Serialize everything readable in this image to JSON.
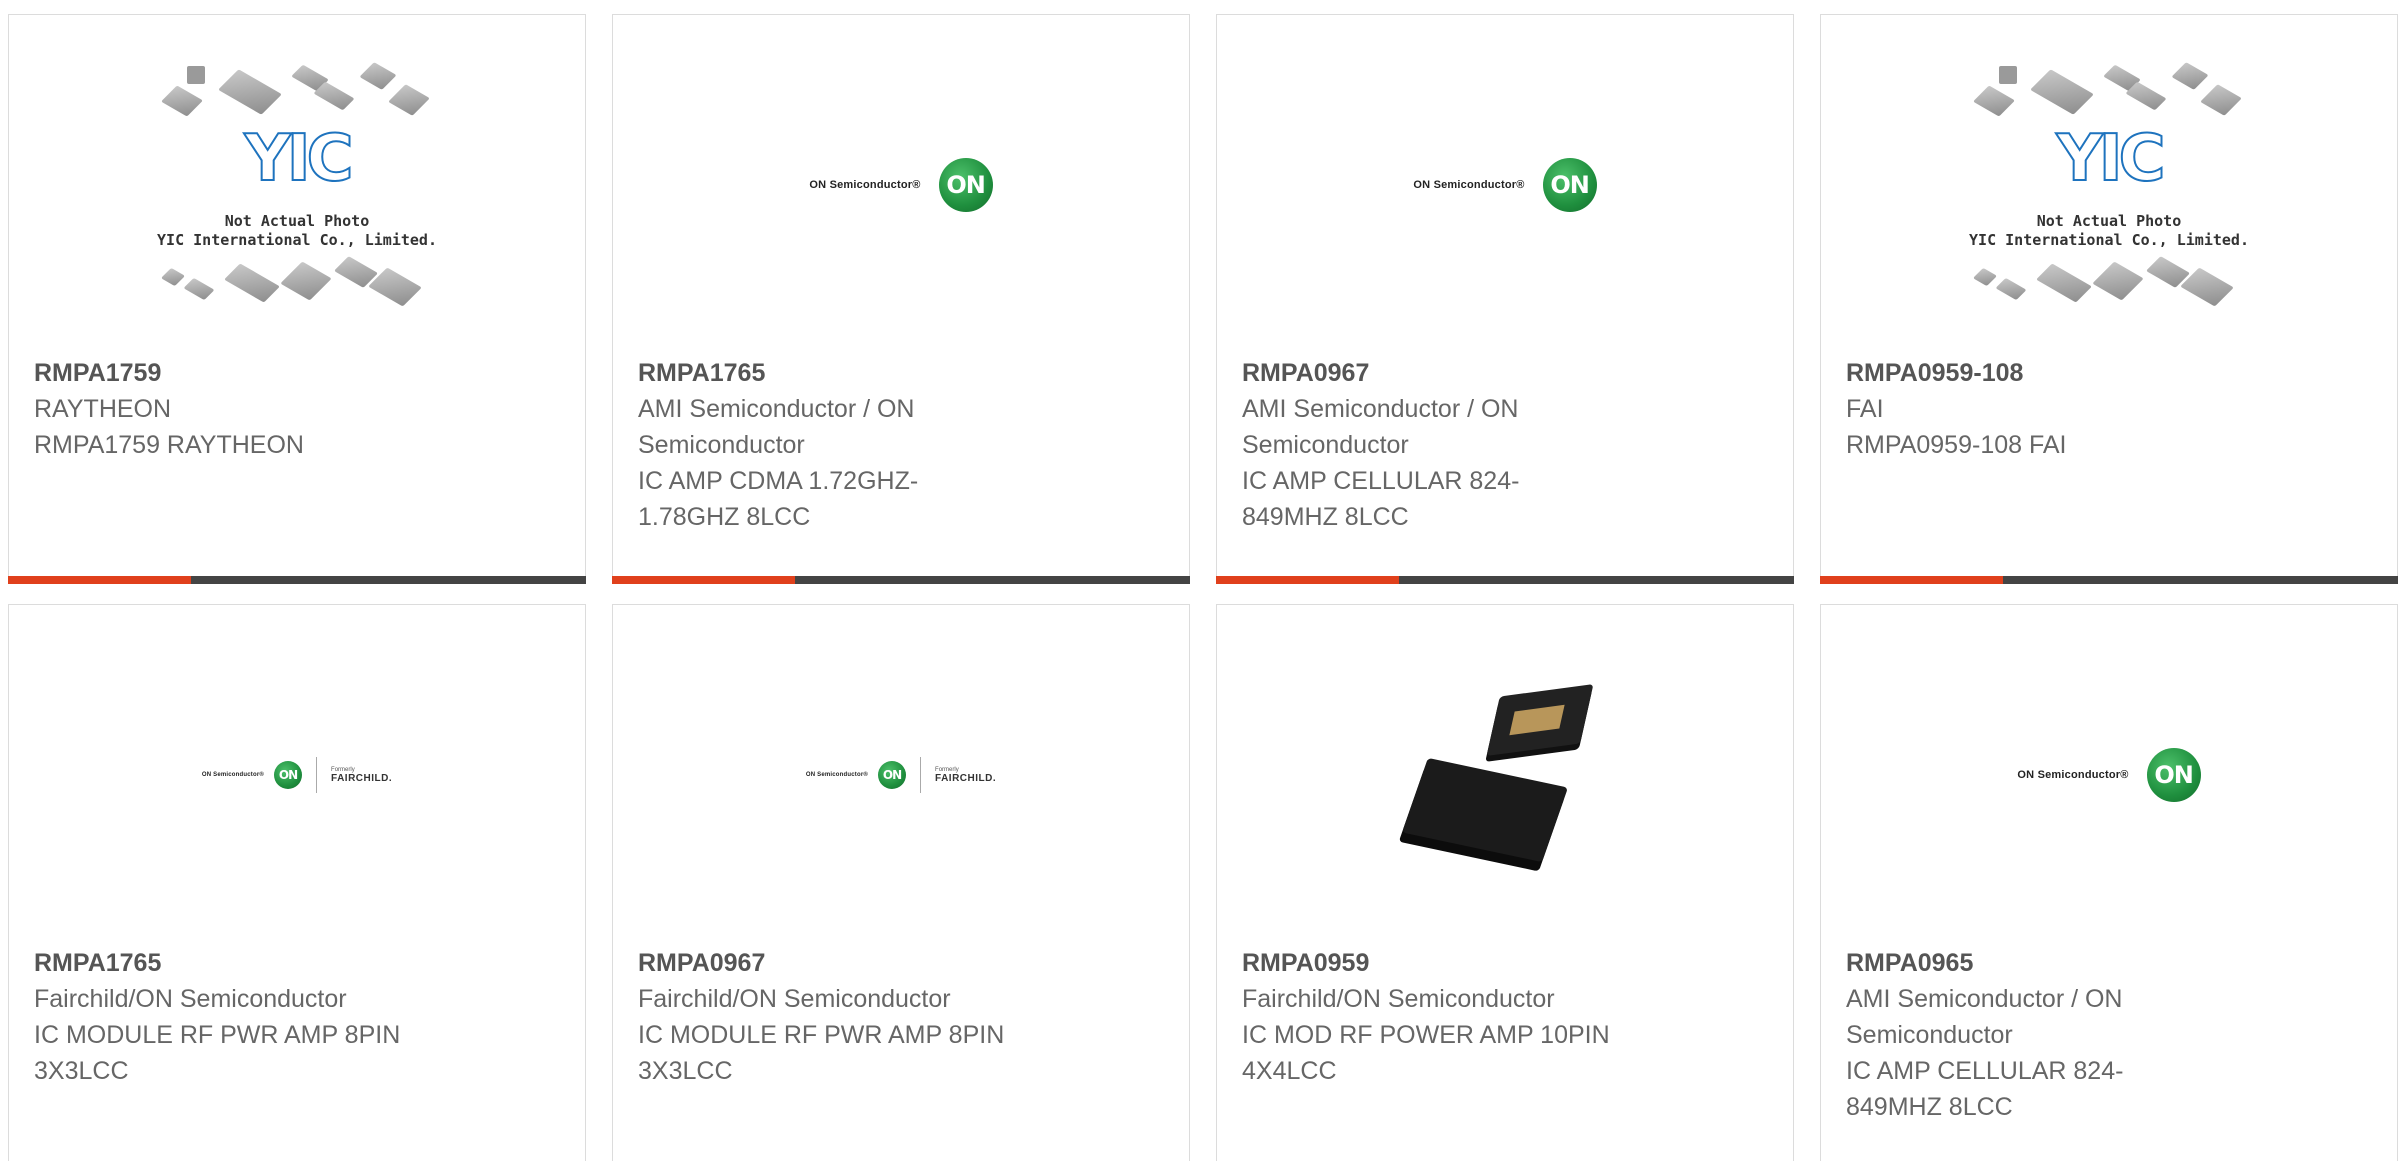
{
  "products": [
    {
      "part": "RMPA1759",
      "manufacturer": "RAYTHEON",
      "description_lines": [
        "RMPA1759 RAYTHEON"
      ],
      "image": "yic-placeholder",
      "image_text": {
        "line1": "Not Actual Photo",
        "line2": "YIC International Co., Limited.",
        "logo": "YIC"
      }
    },
    {
      "part": "RMPA1765",
      "manufacturer_lines": [
        "AMI Semiconductor / ON",
        "Semiconductor"
      ],
      "description_lines": [
        "IC AMP CDMA 1.72GHZ-",
        "1.78GHZ 8LCC"
      ],
      "image": "on-semi-logo",
      "image_text": {
        "brand": "ON Semiconductor®",
        "mark": "ON"
      }
    },
    {
      "part": "RMPA0967",
      "manufacturer_lines": [
        "AMI Semiconductor / ON",
        "Semiconductor"
      ],
      "description_lines": [
        "IC AMP CELLULAR 824-",
        "849MHZ 8LCC"
      ],
      "image": "on-semi-logo",
      "image_text": {
        "brand": "ON Semiconductor®",
        "mark": "ON"
      }
    },
    {
      "part": "RMPA0959-108",
      "manufacturer": "FAI",
      "description_lines": [
        "RMPA0959-108 FAI"
      ],
      "image": "yic-placeholder",
      "image_text": {
        "line1": "Not Actual Photo",
        "line2": "YIC International Co., Limited.",
        "logo": "YIC"
      }
    },
    {
      "part": "RMPA1765",
      "manufacturer": "Fairchild/ON Semiconductor",
      "description_lines": [
        "IC MODULE RF PWR AMP 8PIN",
        "3X3LCC"
      ],
      "image": "on-fairchild-logo",
      "image_text": {
        "brand": "ON Semiconductor®",
        "mark": "ON",
        "formerly": "Formerly",
        "fairchild": "FAIRCHILD."
      }
    },
    {
      "part": "RMPA0967",
      "manufacturer": "Fairchild/ON Semiconductor",
      "description_lines": [
        "IC MODULE RF PWR AMP 8PIN",
        "3X3LCC"
      ],
      "image": "on-fairchild-logo",
      "image_text": {
        "brand": "ON Semiconductor®",
        "mark": "ON",
        "formerly": "Formerly",
        "fairchild": "FAIRCHILD."
      }
    },
    {
      "part": "RMPA0959",
      "manufacturer": "Fairchild/ON Semiconductor",
      "description_lines": [
        "IC MOD RF POWER AMP 10PIN",
        "4X4LCC"
      ],
      "image": "chip-photo"
    },
    {
      "part": "RMPA0965",
      "manufacturer_lines": [
        "AMI Semiconductor / ON",
        "Semiconductor"
      ],
      "description_lines": [
        "IC AMP CELLULAR 824-",
        "849MHZ 8LCC"
      ],
      "image": "on-semi-logo",
      "image_text": {
        "brand": "ON Semiconductor®",
        "mark": "ON"
      }
    }
  ],
  "colors": {
    "accent": "#e0401c",
    "bar": "#444444",
    "text": "#666666",
    "on_green": "#1f8f3e",
    "yic_blue": "#1e73be"
  }
}
